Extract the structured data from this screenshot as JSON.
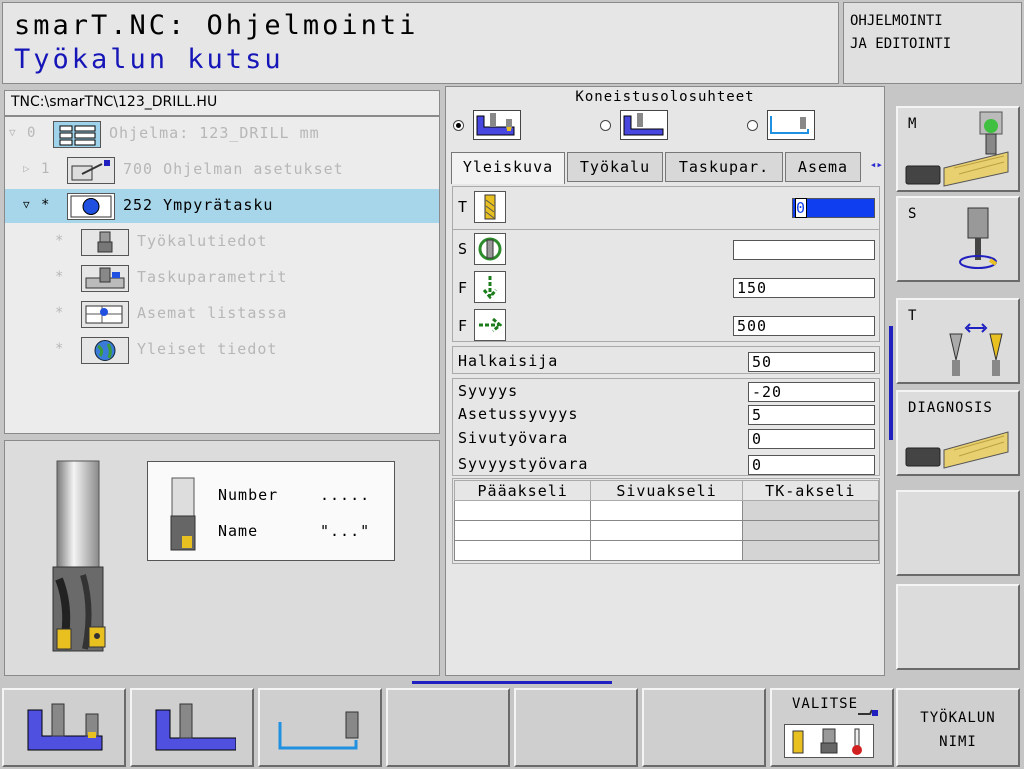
{
  "header": {
    "title": "smarT.NC: Ohjelmointi",
    "subtitle": "Työkalun kutsu",
    "mode_line1": "OHJELMOINTI",
    "mode_line2": "JA EDITOINTI"
  },
  "tree": {
    "path": "TNC:\\smarTNC\\123_DRILL.HU",
    "rows": [
      {
        "num": "0",
        "text": "Ohjelma: 123_DRILL mm",
        "icon": "program-icon"
      },
      {
        "num": "1",
        "text": "700 Ohjelman asetukset",
        "icon": "program-settings-icon"
      },
      {
        "num": "*",
        "text": "252 Ympyrätasku",
        "icon": "circular-pocket-icon"
      },
      {
        "num": "*",
        "text": "Työkalutiedot",
        "icon": "tool-data-icon"
      },
      {
        "num": "*",
        "text": "Taskuparametrit",
        "icon": "pocket-parameters-icon"
      },
      {
        "num": "*",
        "text": "Asemat listassa",
        "icon": "positions-icon"
      },
      {
        "num": "*",
        "text": "Yleiset tiedot",
        "icon": "globe-icon"
      }
    ]
  },
  "preview": {
    "number_label": "Number",
    "number_value": ".....",
    "name_label": "Name",
    "name_value": "\"...\""
  },
  "conditions": {
    "title": "Koneistusolosuhteet",
    "selected": 0
  },
  "tabs": [
    "Yleiskuva",
    "Työkalu",
    "Taskupar.",
    "Asema"
  ],
  "fields": {
    "t_label": "T",
    "t_value": "0",
    "s_label": "S",
    "s_value": "",
    "f1_label": "F",
    "f1_value": "150",
    "f2_label": "F",
    "f2_value": "500",
    "diameter_label": "Halkaisija",
    "diameter_value": "50",
    "depth_label": "Syvyys",
    "depth_value": "-20",
    "plunge_label": "Asetussyvyys",
    "plunge_value": "5",
    "side_allow_label": "Sivutyövara",
    "side_allow_value": "0",
    "depth_allow_label": "Syvyystyövara",
    "depth_allow_value": "0"
  },
  "grid": {
    "headers": [
      "Pääakseli",
      "Sivuakseli",
      "TK-akseli"
    ]
  },
  "softkeys_side": [
    {
      "label": "M",
      "icon": "m-function-icon"
    },
    {
      "label": "S",
      "icon": "spindle-icon"
    },
    {
      "label": "T",
      "icon": "tool-change-icon"
    },
    {
      "label": "DIAGNOSIS",
      "icon": "diagnosis-icon"
    },
    {
      "label": ""
    },
    {
      "label": ""
    }
  ],
  "softkeys_bottom": {
    "select_label": "VALITSE",
    "tool_name_line1": "TYÖKALUN",
    "tool_name_line2": "NIMI"
  },
  "colors": {
    "accent_blue": "#1515b8",
    "selection": "#a7d6ea"
  }
}
